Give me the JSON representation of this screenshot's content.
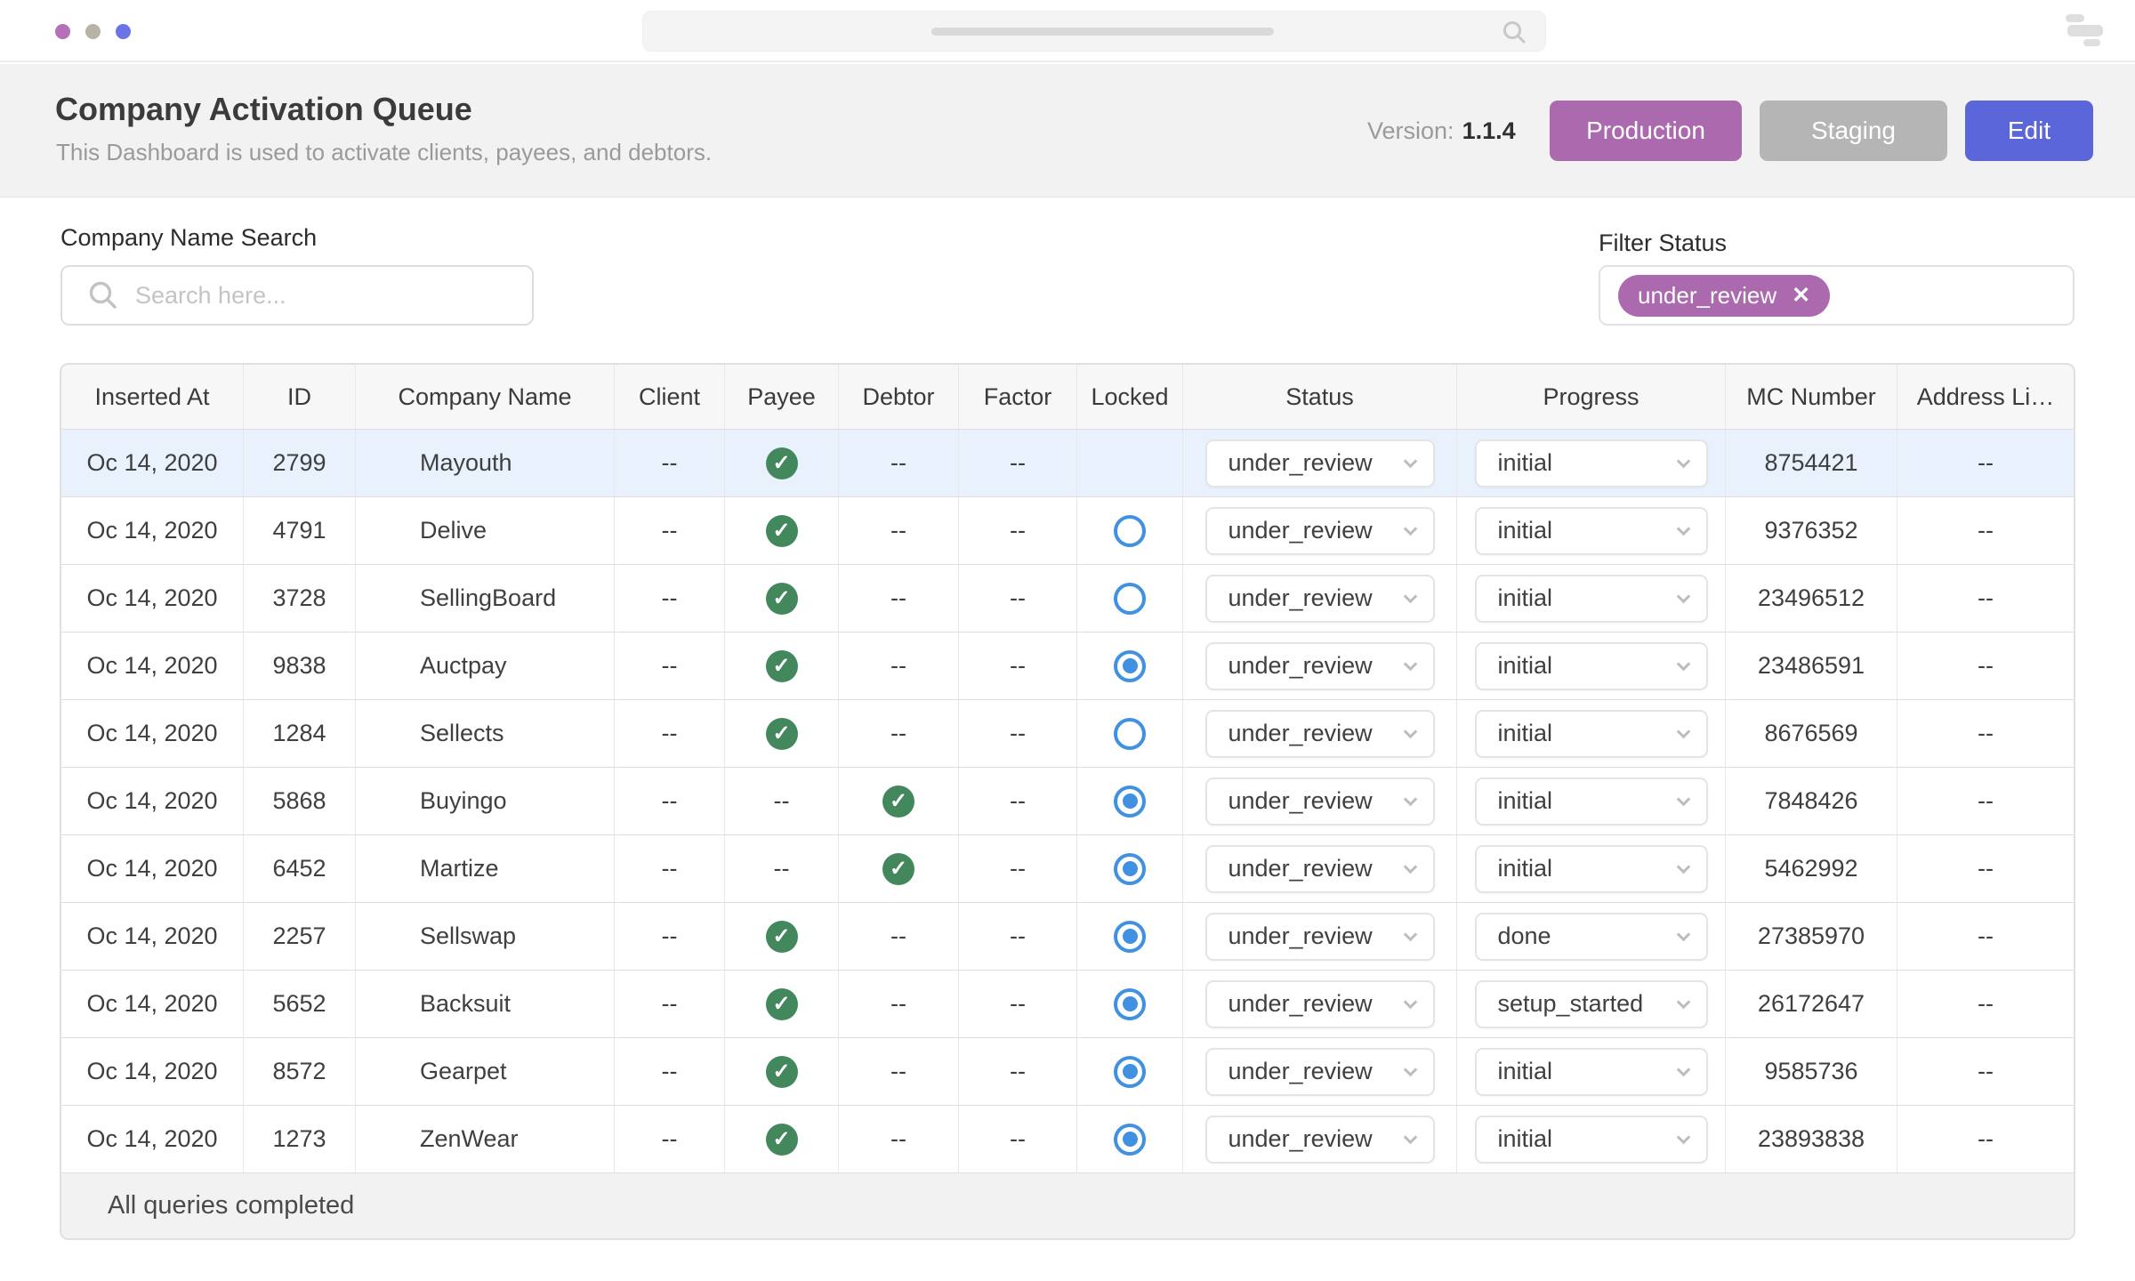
{
  "colors": {
    "dot_purple": "#b570b8",
    "dot_olive": "#b8b3a4",
    "dot_blue": "#6a74e6",
    "production": "#ab69ae",
    "staging": "#b5b5b5",
    "edit": "#5a66d9",
    "chip": "#ab69ae",
    "check_green": "#43885c",
    "radio_blue": "#4191e2",
    "row_highlight": "#e9f2fc"
  },
  "icons": {
    "check": "✓",
    "close": "✕"
  },
  "header": {
    "title": "Company Activation Queue",
    "subtitle": "This Dashboard is used to activate clients, payees, and debtors.",
    "version_label": "Version:",
    "version_value": "1.1.4",
    "buttons": {
      "production": "Production",
      "staging": "Staging",
      "edit": "Edit"
    }
  },
  "filters": {
    "search_label": "Company Name Search",
    "search_placeholder": "Search here...",
    "search_value": "",
    "filter_label": "Filter Status",
    "filter_chip": "under_review"
  },
  "table": {
    "columns": [
      "Inserted At",
      "ID",
      "Company Name",
      "Client",
      "Payee",
      "Debtor",
      "Factor",
      "Locked",
      "Status",
      "Progress",
      "MC Number",
      "Address Li…"
    ],
    "rows": [
      {
        "inserted_at": "Oc 14, 2020",
        "id": "2799",
        "company": "Mayouth",
        "client": "--",
        "payee": "check",
        "debtor": "--",
        "factor": "--",
        "locked": "",
        "status": "under_review",
        "progress": "initial",
        "mc_number": "8754421",
        "address": "--",
        "highlighted": true
      },
      {
        "inserted_at": "Oc 14, 2020",
        "id": "4791",
        "company": "Delive",
        "client": "--",
        "payee": "check",
        "debtor": "--",
        "factor": "--",
        "locked": "off",
        "status": "under_review",
        "progress": "initial",
        "mc_number": "9376352",
        "address": "--",
        "highlighted": false
      },
      {
        "inserted_at": "Oc 14, 2020",
        "id": "3728",
        "company": "SellingBoard",
        "client": "--",
        "payee": "check",
        "debtor": "--",
        "factor": "--",
        "locked": "off",
        "status": "under_review",
        "progress": "initial",
        "mc_number": "23496512",
        "address": "--",
        "highlighted": false
      },
      {
        "inserted_at": "Oc 14, 2020",
        "id": "9838",
        "company": "Auctpay",
        "client": "--",
        "payee": "check",
        "debtor": "--",
        "factor": "--",
        "locked": "on",
        "status": "under_review",
        "progress": "initial",
        "mc_number": "23486591",
        "address": "--",
        "highlighted": false
      },
      {
        "inserted_at": "Oc 14, 2020",
        "id": "1284",
        "company": "Sellects",
        "client": "--",
        "payee": "check",
        "debtor": "--",
        "factor": "--",
        "locked": "off",
        "status": "under_review",
        "progress": "initial",
        "mc_number": "8676569",
        "address": "--",
        "highlighted": false
      },
      {
        "inserted_at": "Oc 14, 2020",
        "id": "5868",
        "company": "Buyingo",
        "client": "--",
        "payee": "--",
        "debtor": "check",
        "factor": "--",
        "locked": "on",
        "status": "under_review",
        "progress": "initial",
        "mc_number": "7848426",
        "address": "--",
        "highlighted": false
      },
      {
        "inserted_at": "Oc 14, 2020",
        "id": "6452",
        "company": "Martize",
        "client": "--",
        "payee": "--",
        "debtor": "check",
        "factor": "--",
        "locked": "on",
        "status": "under_review",
        "progress": "initial",
        "mc_number": "5462992",
        "address": "--",
        "highlighted": false
      },
      {
        "inserted_at": "Oc 14, 2020",
        "id": "2257",
        "company": "Sellswap",
        "client": "--",
        "payee": "check",
        "debtor": "--",
        "factor": "--",
        "locked": "on",
        "status": "under_review",
        "progress": "done",
        "mc_number": "27385970",
        "address": "--",
        "highlighted": false
      },
      {
        "inserted_at": "Oc 14, 2020",
        "id": "5652",
        "company": "Backsuit",
        "client": "--",
        "payee": "check",
        "debtor": "--",
        "factor": "--",
        "locked": "on",
        "status": "under_review",
        "progress": "setup_started",
        "mc_number": "26172647",
        "address": "--",
        "highlighted": false
      },
      {
        "inserted_at": "Oc 14, 2020",
        "id": "8572",
        "company": "Gearpet",
        "client": "--",
        "payee": "check",
        "debtor": "--",
        "factor": "--",
        "locked": "on",
        "status": "under_review",
        "progress": "initial",
        "mc_number": "9585736",
        "address": "--",
        "highlighted": false
      },
      {
        "inserted_at": "Oc 14, 2020",
        "id": "1273",
        "company": "ZenWear",
        "client": "--",
        "payee": "check",
        "debtor": "--",
        "factor": "--",
        "locked": "on",
        "status": "under_review",
        "progress": "initial",
        "mc_number": "23893838",
        "address": "--",
        "highlighted": false
      }
    ],
    "footer": "All queries completed"
  }
}
